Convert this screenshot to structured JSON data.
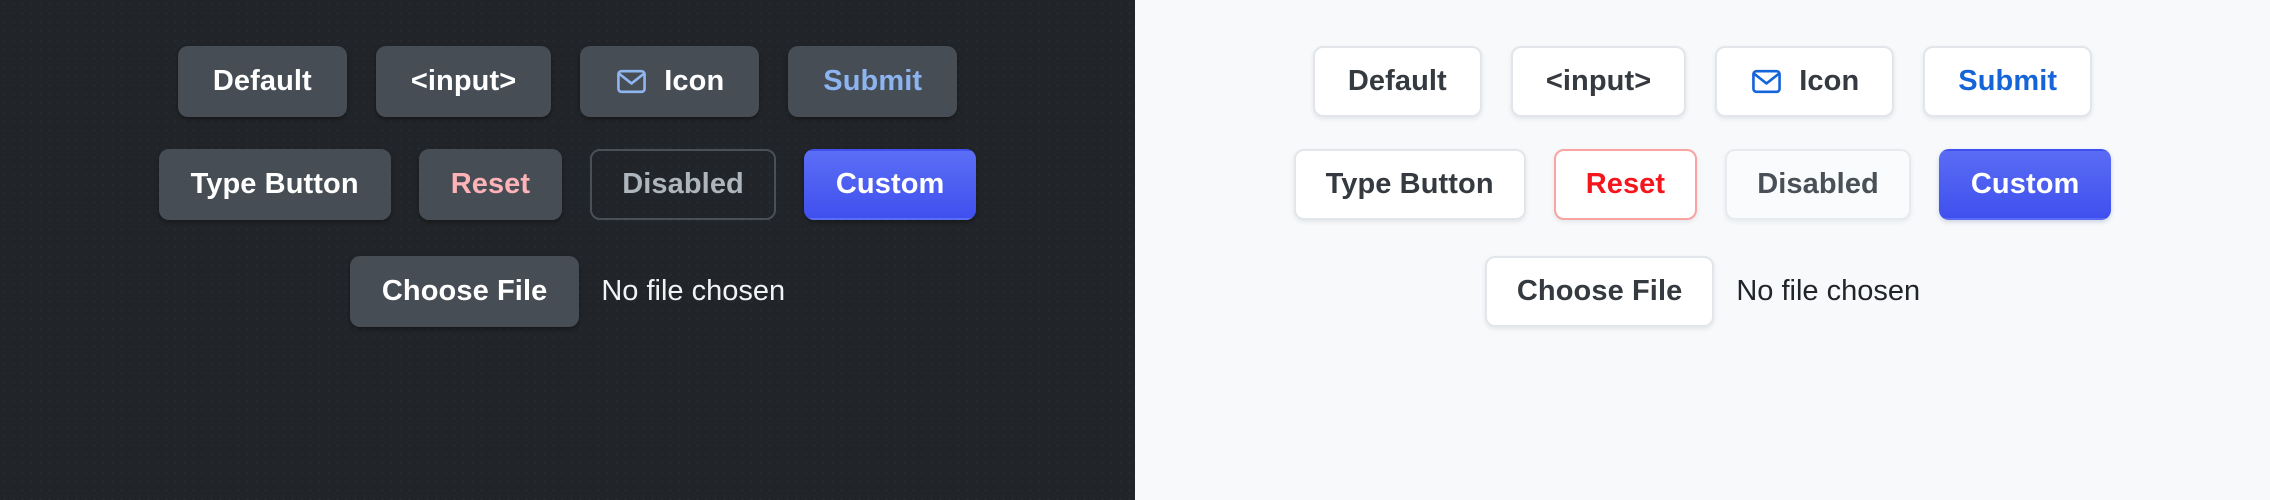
{
  "theme_colors": {
    "dark_panel_bg": "#212428",
    "light_panel_bg": "#f7f9fb",
    "dark_button_bg": "#474d55",
    "light_button_bg": "#ffffff",
    "accent_blue": "#4050ef",
    "dark_submit_text": "#8cb4f0",
    "light_submit_text": "#1565d8",
    "dark_reset_text": "#ffb3b8",
    "light_reset_text": "#f4161d",
    "light_reset_border": "#f9a3a3",
    "dark_disabled_text": "#adb5bd",
    "light_disabled_text": "#495057"
  },
  "panels": [
    {
      "theme": "dark",
      "rows": [
        {
          "name": "primary-row",
          "buttons": [
            {
              "id": "default",
              "label": "Default",
              "icon": null
            },
            {
              "id": "input",
              "label": "<input>",
              "icon": null
            },
            {
              "id": "icon",
              "label": "Icon",
              "icon": "envelope-icon"
            },
            {
              "id": "submit",
              "label": "Submit",
              "icon": null
            }
          ]
        },
        {
          "name": "secondary-row",
          "buttons": [
            {
              "id": "type",
              "label": "Type Button",
              "icon": null
            },
            {
              "id": "reset",
              "label": "Reset",
              "icon": null
            },
            {
              "id": "disabled",
              "label": "Disabled",
              "icon": null
            },
            {
              "id": "custom",
              "label": "Custom",
              "icon": null
            }
          ]
        }
      ],
      "file_input": {
        "button_label": "Choose File",
        "status_text": "No file chosen"
      }
    },
    {
      "theme": "light",
      "rows": [
        {
          "name": "primary-row",
          "buttons": [
            {
              "id": "default",
              "label": "Default",
              "icon": null
            },
            {
              "id": "input",
              "label": "<input>",
              "icon": null
            },
            {
              "id": "icon",
              "label": "Icon",
              "icon": "envelope-icon"
            },
            {
              "id": "submit",
              "label": "Submit",
              "icon": null
            }
          ]
        },
        {
          "name": "secondary-row",
          "buttons": [
            {
              "id": "type",
              "label": "Type Button",
              "icon": null
            },
            {
              "id": "reset",
              "label": "Reset",
              "icon": null
            },
            {
              "id": "disabled",
              "label": "Disabled",
              "icon": null
            },
            {
              "id": "custom",
              "label": "Custom",
              "icon": null
            }
          ]
        }
      ],
      "file_input": {
        "button_label": "Choose File",
        "status_text": "No file chosen"
      }
    }
  ]
}
